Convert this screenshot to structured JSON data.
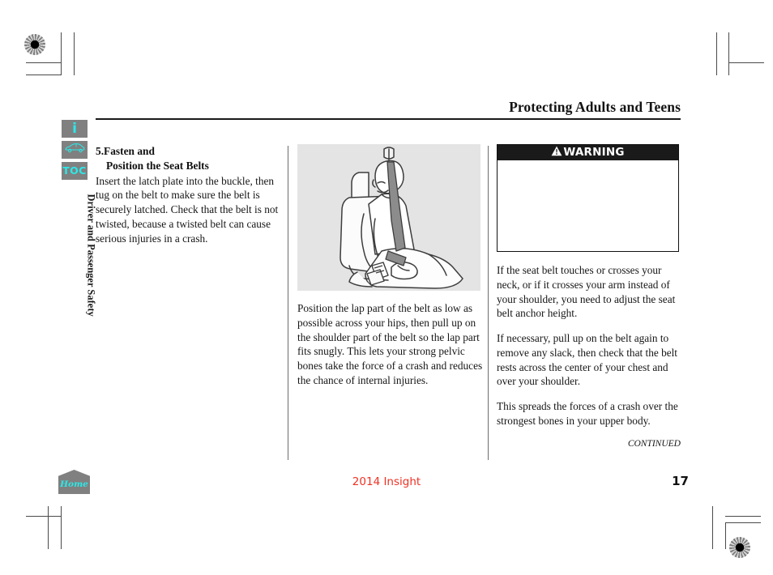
{
  "header": {
    "title": "Protecting Adults and Teens"
  },
  "sidebar": {
    "buttons": [
      {
        "name": "info-icon",
        "glyph": "i"
      },
      {
        "name": "vehicle-icon",
        "glyph": ""
      },
      {
        "name": "toc-icon",
        "glyph": "TOC"
      }
    ],
    "section_label": "Driver and Passenger Safety"
  },
  "main": {
    "column_left": {
      "step_number_and_line1": "5.Fasten and",
      "step_line2": "Position the Seat Belts",
      "paragraph": "Insert the latch plate into the buckle, then tug on the belt to make sure the belt is securely latched. Check that the belt is not twisted, because a twisted belt can cause serious injuries in a crash."
    },
    "column_middle": {
      "figure_alt": "occupant-seated-with-seat-belt-illustration",
      "paragraph": "Position the lap part of the belt as low as possible across your hips, then pull up on the shoulder part of the belt so the lap part fits snugly. This lets your strong pelvic bones take the force of a crash and reduces the chance of internal injuries."
    },
    "column_right": {
      "warning_label": "WARNING",
      "warning_body": "",
      "paragraphs": [
        "If the seat belt touches or crosses your neck, or if it crosses your arm instead of your shoulder, you need to adjust the seat belt anchor height.",
        "If necessary, pull up on the belt again to remove any slack, then check that the belt rests across the center of your chest and over your shoulder.",
        "This spreads the forces of a crash over the strongest bones in your upper body."
      ],
      "continued_label": "CONTINUED"
    }
  },
  "footer": {
    "home_label": "Home",
    "model": "2014 Insight",
    "page_number": "17"
  },
  "colors": {
    "accent_cyan": "#2ce8e8",
    "button_gray": "#808080",
    "model_red": "#ef3124",
    "figure_bg": "#e4e4e4",
    "warning_bar": "#1a1a1a"
  }
}
